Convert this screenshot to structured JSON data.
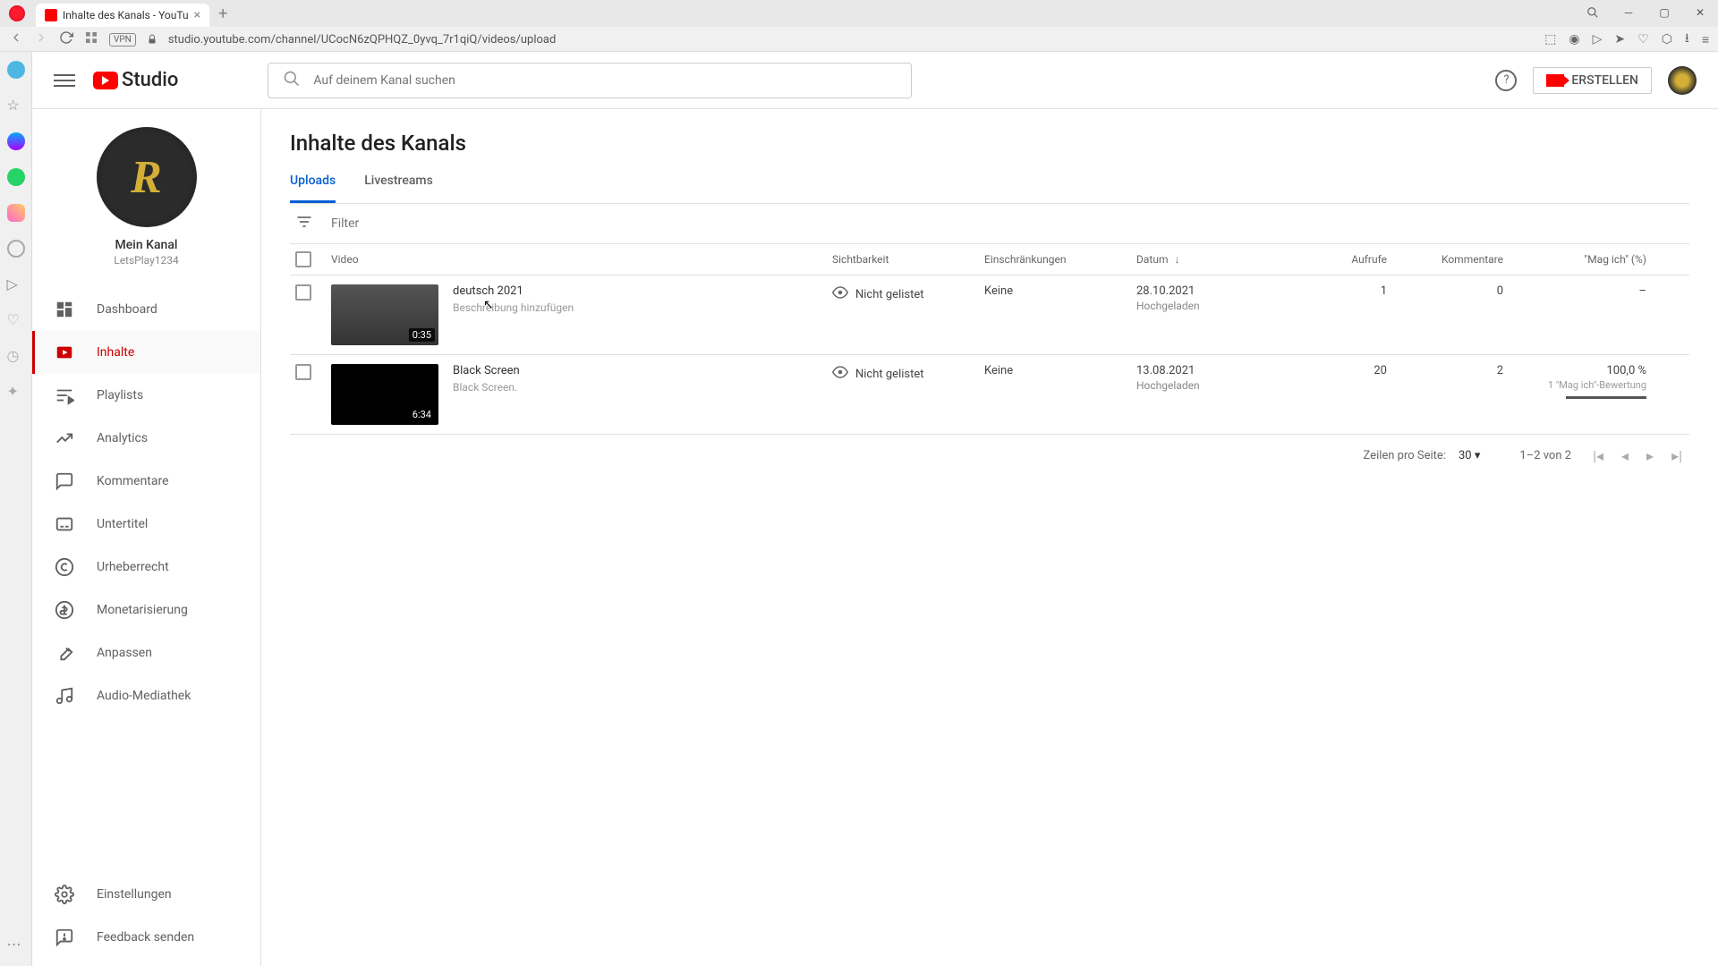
{
  "browser": {
    "tab_title": "Inhalte des Kanals - YouTu",
    "url": "studio.youtube.com/channel/UCocN6zQPHQZ_0yvq_7r1qiQ/videos/upload",
    "vpn_label": "VPN"
  },
  "header": {
    "logo_text": "Studio",
    "search_placeholder": "Auf deinem Kanal suchen",
    "create_label": "ERSTELLEN",
    "avatar_letter": "R"
  },
  "channel": {
    "avatar_letter": "R",
    "label": "Mein Kanal",
    "handle": "LetsPlay1234"
  },
  "nav": {
    "items": [
      {
        "label": "Dashboard",
        "icon": "dashboard"
      },
      {
        "label": "Inhalte",
        "icon": "content",
        "active": true
      },
      {
        "label": "Playlists",
        "icon": "playlists"
      },
      {
        "label": "Analytics",
        "icon": "analytics"
      },
      {
        "label": "Kommentare",
        "icon": "comments"
      },
      {
        "label": "Untertitel",
        "icon": "subtitles"
      },
      {
        "label": "Urheberrecht",
        "icon": "copyright"
      },
      {
        "label": "Monetarisierung",
        "icon": "monetization"
      },
      {
        "label": "Anpassen",
        "icon": "customize"
      },
      {
        "label": "Audio-Mediathek",
        "icon": "audio"
      }
    ],
    "bottom": [
      {
        "label": "Einstellungen",
        "icon": "settings"
      },
      {
        "label": "Feedback senden",
        "icon": "feedback"
      }
    ]
  },
  "page": {
    "title": "Inhalte des Kanals",
    "tabs": [
      {
        "label": "Uploads",
        "active": true
      },
      {
        "label": "Livestreams"
      }
    ],
    "filter_placeholder": "Filter",
    "columns": {
      "video": "Video",
      "visibility": "Sichtbarkeit",
      "restrictions": "Einschränkungen",
      "date": "Datum",
      "views": "Aufrufe",
      "comments": "Kommentare",
      "likes": "\"Mag ich\" (%)"
    },
    "rows": [
      {
        "title": "deutsch 2021",
        "desc": "Beschreibung hinzufügen",
        "duration": "0:35",
        "visibility": "Nicht gelistet",
        "restrictions": "Keine",
        "date": "28.10.2021",
        "date_sub": "Hochgeladen",
        "views": "1",
        "comments": "0",
        "likes": "–",
        "likes_sub": "",
        "like_pct": 0,
        "thumb_bg": "linear-gradient(#555,#333)"
      },
      {
        "title": "Black Screen",
        "desc": "Black Screen.",
        "duration": "6:34",
        "visibility": "Nicht gelistet",
        "restrictions": "Keine",
        "date": "13.08.2021",
        "date_sub": "Hochgeladen",
        "views": "20",
        "comments": "2",
        "likes": "100,0 %",
        "likes_sub": "1 \"Mag ich\"-Bewertung",
        "like_pct": 100,
        "thumb_bg": "#000"
      }
    ],
    "pagination": {
      "rows_label": "Zeilen pro Seite:",
      "rows_value": "30",
      "range": "1–2 von 2"
    }
  }
}
